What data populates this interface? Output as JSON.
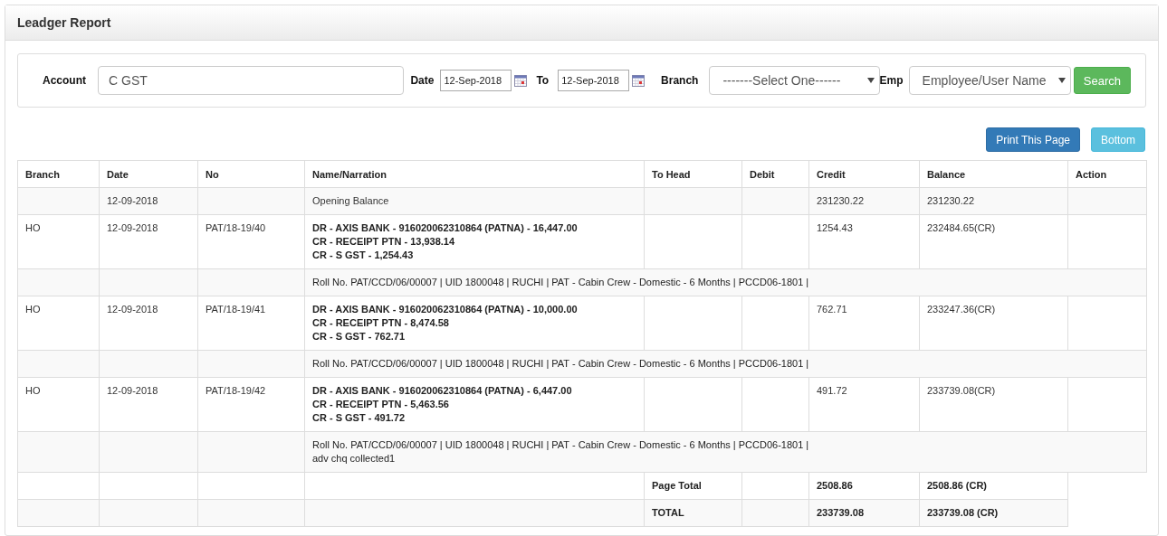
{
  "title": "Leadger Report",
  "filters": {
    "account_label": "Account",
    "account_value": "C GST",
    "date_label": "Date",
    "date_from": "12-Sep-2018",
    "to_label": "To",
    "date_to": "12-Sep-2018",
    "branch_label": "Branch",
    "branch_value": "-------Select One------",
    "emp_label": "Emp",
    "emp_value": "Employee/User Name",
    "search_button": "Search"
  },
  "actions": [
    "Print This Page",
    "Bottom"
  ],
  "table": {
    "columns": [
      "Branch",
      "Date",
      "No",
      "Name/Narration",
      "To Head",
      "Debit",
      "Credit",
      "Balance",
      "Action"
    ],
    "rows": [
      {
        "kind": "opening",
        "date": "12-09-2018",
        "narration": "Opening Balance",
        "credit": "231230.22",
        "balance": "231230.22"
      },
      {
        "kind": "entry",
        "branch": "HO",
        "date": "12-09-2018",
        "no": "PAT/18-19/40",
        "lines": [
          "DR - AXIS BANK - 916020062310864 (PATNA) - 16,447.00",
          "CR - RECEIPT PTN - 13,938.14",
          "CR - S GST - 1,254.43"
        ],
        "credit": "1254.43",
        "balance": "232484.65(CR)"
      },
      {
        "kind": "narration",
        "lines": [
          "Roll No. PAT/CCD/06/00007 | UID 1800048 | RUCHI | PAT - Cabin Crew - Domestic - 6 Months | PCCD06-1801 |"
        ]
      },
      {
        "kind": "entry",
        "branch": "HO",
        "date": "12-09-2018",
        "no": "PAT/18-19/41",
        "lines": [
          "DR - AXIS BANK - 916020062310864 (PATNA) - 10,000.00",
          "CR - RECEIPT PTN - 8,474.58",
          "CR - S GST - 762.71"
        ],
        "credit": "762.71",
        "balance": "233247.36(CR)"
      },
      {
        "kind": "narration",
        "lines": [
          "Roll No. PAT/CCD/06/00007 | UID 1800048 | RUCHI | PAT - Cabin Crew - Domestic - 6 Months | PCCD06-1801 |"
        ]
      },
      {
        "kind": "entry",
        "branch": "HO",
        "date": "12-09-2018",
        "no": "PAT/18-19/42",
        "lines": [
          "DR - AXIS BANK - 916020062310864 (PATNA) - 6,447.00",
          "CR - RECEIPT PTN - 5,463.56",
          "CR - S GST - 491.72"
        ],
        "credit": "491.72",
        "balance": "233739.08(CR)"
      },
      {
        "kind": "narration",
        "lines": [
          "Roll No. PAT/CCD/06/00007 | UID 1800048 | RUCHI | PAT - Cabin Crew - Domestic - 6 Months | PCCD06-1801 |",
          "adv chq collected1"
        ]
      },
      {
        "kind": "total",
        "label": "Page Total",
        "credit": "2508.86",
        "balance": "2508.86 (CR)"
      },
      {
        "kind": "total",
        "label": "TOTAL",
        "credit": "233739.08",
        "balance": "233739.08 (CR)"
      }
    ]
  }
}
